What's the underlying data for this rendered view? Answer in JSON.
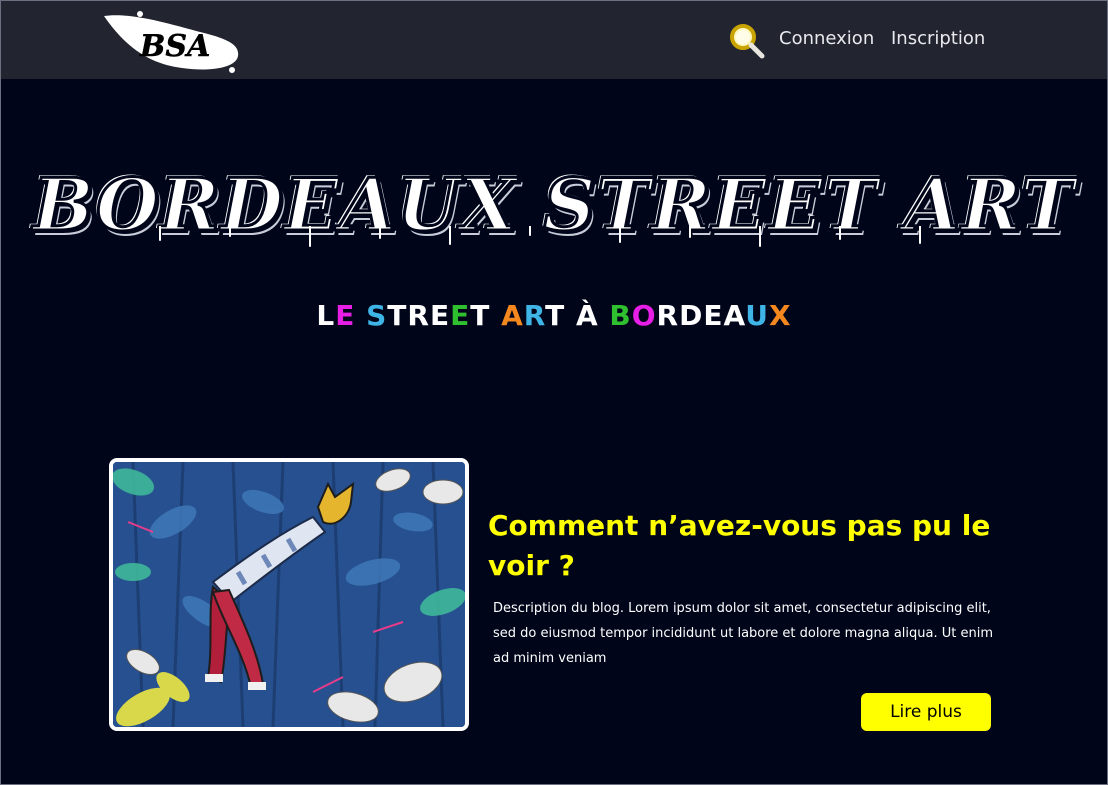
{
  "header": {
    "logo_text": "BSA",
    "search_icon": "search-icon",
    "login_label": "Connexion",
    "signup_label": "Inscription"
  },
  "hero": {
    "title": "BORDEAUX STREET ART",
    "subtitle_letters": [
      {
        "t": "L",
        "c": "#ffffff"
      },
      {
        "t": "E",
        "c": "#e61ee6"
      },
      {
        "t": " ",
        "c": "#ffffff"
      },
      {
        "t": "S",
        "c": "#3fb4e6"
      },
      {
        "t": "T",
        "c": "#ffffff"
      },
      {
        "t": "R",
        "c": "#ffffff"
      },
      {
        "t": "E",
        "c": "#ffffff"
      },
      {
        "t": "E",
        "c": "#2fc02f"
      },
      {
        "t": "T",
        "c": "#ffffff"
      },
      {
        "t": " ",
        "c": "#ffffff"
      },
      {
        "t": "A",
        "c": "#f5871f"
      },
      {
        "t": "R",
        "c": "#3fb4e6"
      },
      {
        "t": "T",
        "c": "#ffffff"
      },
      {
        "t": " ",
        "c": "#ffffff"
      },
      {
        "t": "À",
        "c": "#ffffff"
      },
      {
        "t": " ",
        "c": "#ffffff"
      },
      {
        "t": "B",
        "c": "#2fc02f"
      },
      {
        "t": "O",
        "c": "#e61ee6"
      },
      {
        "t": "R",
        "c": "#ffffff"
      },
      {
        "t": "D",
        "c": "#ffffff"
      },
      {
        "t": "E",
        "c": "#ffffff"
      },
      {
        "t": "A",
        "c": "#ffffff"
      },
      {
        "t": "U",
        "c": "#3fb4e6"
      },
      {
        "t": "X",
        "c": "#f5871f"
      }
    ]
  },
  "post": {
    "title": "Comment n’avez-vous pas pu le voir ?",
    "description": "Description du blog. Lorem ipsum dolor sit amet, consectetur adipiscing elit, sed do eiusmod tempor incididunt ut labore et dolore magna aliqua. Ut enim ad minim veniam",
    "read_more_label": "Lire plus"
  },
  "colors": {
    "background": "#01051a",
    "navbar": "#22252f",
    "accent": "#ffff00"
  }
}
